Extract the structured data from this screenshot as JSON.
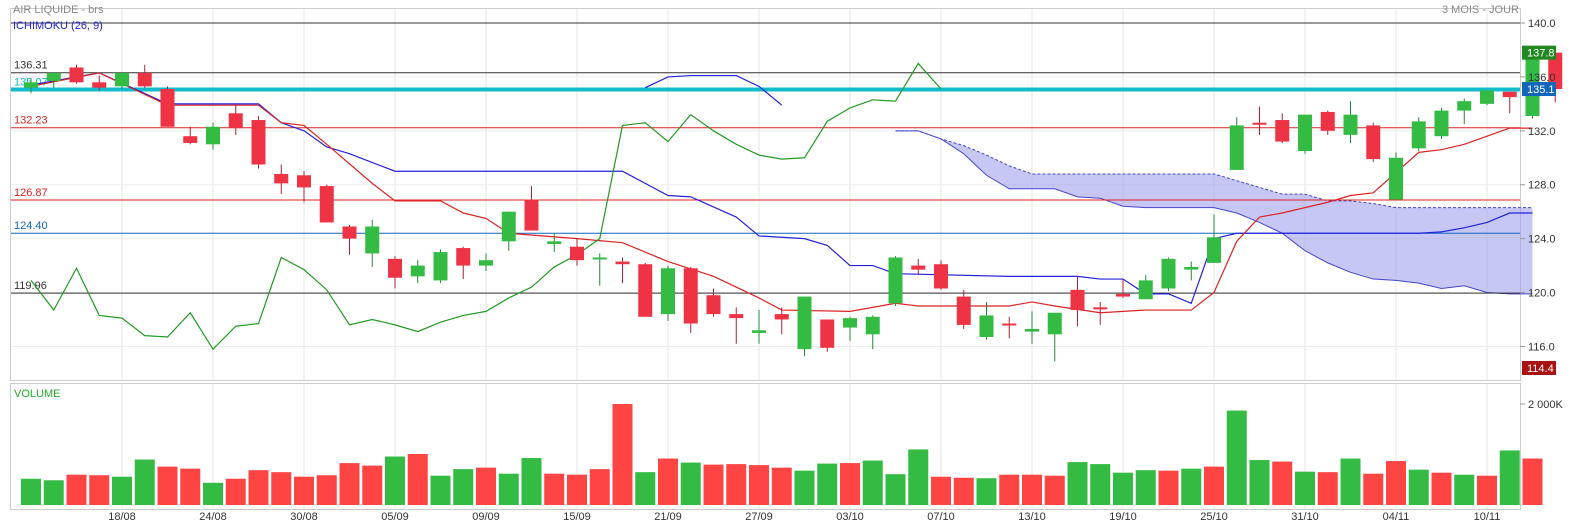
{
  "header": {
    "instrument": "AIR LIQUIDE - brs",
    "period": "3 MOIS - JOUR",
    "indicator": "ICHIMOKU (26, 9)",
    "volume_title": "VOLUME"
  },
  "colors": {
    "up": "#33bb44",
    "down": "#ee3344",
    "tenkan": "#dd2222",
    "kijun": "#2222dd",
    "chikou": "#229922",
    "cloud": "#9999ee",
    "last_line": "#11bbcc",
    "ref_line": "#333333",
    "vol_up": "#33bb44",
    "vol_down": "#ff4444"
  },
  "chart_data": {
    "type": "candlestick",
    "price_axis": {
      "min": 114.4,
      "max": 140.0,
      "ticks": [
        "140.0",
        "136.0",
        "132.0",
        "128.0",
        "124.0",
        "120.0",
        "116.0"
      ]
    },
    "x_labels": [
      "18/08",
      "24/08",
      "30/08",
      "05/09",
      "09/09",
      "15/09",
      "21/09",
      "27/09",
      "03/10",
      "07/10",
      "13/10",
      "19/10",
      "25/10",
      "31/10",
      "04/11",
      "10/11"
    ],
    "x_label_index": [
      4,
      8,
      12,
      16,
      20,
      24,
      28,
      32,
      36,
      40,
      44,
      48,
      52,
      56,
      60,
      64
    ],
    "reference_lines": [
      {
        "label": "136.31",
        "value": 136.31,
        "color": "#333333"
      },
      {
        "label": "135.07",
        "value": 135.07,
        "color": "#11bbcc"
      },
      {
        "label": "132.23",
        "value": 132.23,
        "color": "#dd2222"
      },
      {
        "label": "126.87",
        "value": 126.87,
        "color": "#dd2222"
      },
      {
        "label": "124.40",
        "value": 124.4,
        "color": "#1166bb"
      },
      {
        "label": "119.96",
        "value": 119.96,
        "color": "#333333"
      }
    ],
    "top_line_value": 140.0,
    "price_badges": [
      {
        "label": "137.8",
        "value": 137.8,
        "color": "#228822"
      },
      {
        "label": "135.1",
        "value": 135.1,
        "color": "#1166bb"
      },
      {
        "label": "114.4",
        "value": 114.4,
        "color": "#aa1111"
      }
    ],
    "candles": [
      [
        135.2,
        135.9,
        134.8,
        135.6
      ],
      [
        135.7,
        136.1,
        135.2,
        136.3
      ],
      [
        136.7,
        136.9,
        135.5,
        135.6
      ],
      [
        135.6,
        136.1,
        135.0,
        135.2
      ],
      [
        135.3,
        136.3,
        135.1,
        136.3
      ],
      [
        136.3,
        136.9,
        135.2,
        135.3
      ],
      [
        135.1,
        135.3,
        132.3,
        132.3
      ],
      [
        131.6,
        132.3,
        131.0,
        131.1
      ],
      [
        131.0,
        132.6,
        130.6,
        132.3
      ],
      [
        133.3,
        134.0,
        131.7,
        132.2
      ],
      [
        132.8,
        133.1,
        129.2,
        129.5
      ],
      [
        128.8,
        129.5,
        127.3,
        128.1
      ],
      [
        128.7,
        129.0,
        126.7,
        127.8
      ],
      [
        127.9,
        128.0,
        125.2,
        125.2
      ],
      [
        124.9,
        125.0,
        122.8,
        124.0
      ],
      [
        122.9,
        125.4,
        121.9,
        124.9
      ],
      [
        122.5,
        122.7,
        120.3,
        121.1
      ],
      [
        121.2,
        122.4,
        120.7,
        122.0
      ],
      [
        120.9,
        123.2,
        120.7,
        123.0
      ],
      [
        123.3,
        123.4,
        121.0,
        122.0
      ],
      [
        122.0,
        122.9,
        121.6,
        122.4
      ],
      [
        123.8,
        126.0,
        123.1,
        126.0
      ],
      [
        126.9,
        127.9,
        124.6,
        124.6
      ],
      [
        123.6,
        124.4,
        123.0,
        123.8
      ],
      [
        123.4,
        124.0,
        122.0,
        122.4
      ],
      [
        122.5,
        122.9,
        120.5,
        122.6
      ],
      [
        122.3,
        122.6,
        120.7,
        122.1
      ],
      [
        122.1,
        122.2,
        120.0,
        118.2
      ],
      [
        118.4,
        122.0,
        117.9,
        121.8
      ],
      [
        121.8,
        121.9,
        117.0,
        117.7
      ],
      [
        119.8,
        120.3,
        118.2,
        118.4
      ],
      [
        118.4,
        118.9,
        116.2,
        118.1
      ],
      [
        117.0,
        118.7,
        116.2,
        117.2
      ],
      [
        118.4,
        118.9,
        116.9,
        118.0
      ],
      [
        115.8,
        118.3,
        115.3,
        119.7
      ],
      [
        118.0,
        118.0,
        115.6,
        115.9
      ],
      [
        117.4,
        118.2,
        116.4,
        118.1
      ],
      [
        116.9,
        118.3,
        115.8,
        118.2
      ],
      [
        119.2,
        122.7,
        119.0,
        122.6
      ],
      [
        122.0,
        122.5,
        121.3,
        121.7
      ],
      [
        122.1,
        122.4,
        120.2,
        120.3
      ],
      [
        119.7,
        120.2,
        117.3,
        117.6
      ],
      [
        116.7,
        119.3,
        116.5,
        118.3
      ],
      [
        117.7,
        118.2,
        116.6,
        117.6
      ],
      [
        117.1,
        118.6,
        116.2,
        117.3
      ],
      [
        116.9,
        118.3,
        114.9,
        118.5
      ],
      [
        120.2,
        121.2,
        117.5,
        118.7
      ],
      [
        118.9,
        119.3,
        117.6,
        118.8
      ],
      [
        119.9,
        121.0,
        119.6,
        119.7
      ],
      [
        119.5,
        121.3,
        120.5,
        120.9
      ],
      [
        120.3,
        122.6,
        120.1,
        122.5
      ],
      [
        121.7,
        122.3,
        120.9,
        121.9
      ],
      [
        122.2,
        125.8,
        122.2,
        124.1
      ],
      [
        129.1,
        133.0,
        129.1,
        132.4
      ],
      [
        132.6,
        133.8,
        131.7,
        132.5
      ],
      [
        132.8,
        133.3,
        131.1,
        131.2
      ],
      [
        130.5,
        133.2,
        130.3,
        133.2
      ],
      [
        133.4,
        133.5,
        131.7,
        132.0
      ],
      [
        131.7,
        134.2,
        131.1,
        133.2
      ],
      [
        132.4,
        132.6,
        129.7,
        129.9
      ],
      [
        126.9,
        130.4,
        126.9,
        130.0
      ],
      [
        130.7,
        133.0,
        130.5,
        132.7
      ],
      [
        131.6,
        133.7,
        131.4,
        133.5
      ],
      [
        133.5,
        134.4,
        132.5,
        134.2
      ],
      [
        134.0,
        135.0,
        133.9,
        135.0
      ],
      [
        134.9,
        134.7,
        133.3,
        134.5
      ],
      [
        133.1,
        137.9,
        132.9,
        137.8
      ],
      [
        137.8,
        137.8,
        134.1,
        135.1
      ]
    ],
    "volume_axis": {
      "max": 2000,
      "tick_label": "2 000K"
    },
    "volumes": [
      [
        520,
        1
      ],
      [
        490,
        1
      ],
      [
        600,
        0
      ],
      [
        590,
        0
      ],
      [
        560,
        1
      ],
      [
        900,
        1
      ],
      [
        760,
        0
      ],
      [
        720,
        0
      ],
      [
        440,
        1
      ],
      [
        520,
        0
      ],
      [
        690,
        0
      ],
      [
        650,
        0
      ],
      [
        560,
        0
      ],
      [
        590,
        0
      ],
      [
        830,
        0
      ],
      [
        780,
        0
      ],
      [
        960,
        1
      ],
      [
        1010,
        0
      ],
      [
        580,
        1
      ],
      [
        710,
        1
      ],
      [
        740,
        0
      ],
      [
        620,
        1
      ],
      [
        930,
        1
      ],
      [
        620,
        0
      ],
      [
        600,
        0
      ],
      [
        710,
        0
      ],
      [
        2000,
        0
      ],
      [
        650,
        1
      ],
      [
        920,
        0
      ],
      [
        840,
        1
      ],
      [
        800,
        0
      ],
      [
        810,
        0
      ],
      [
        790,
        0
      ],
      [
        740,
        0
      ],
      [
        680,
        1
      ],
      [
        820,
        1
      ],
      [
        830,
        0
      ],
      [
        880,
        1
      ],
      [
        610,
        1
      ],
      [
        1100,
        1
      ],
      [
        560,
        0
      ],
      [
        540,
        0
      ],
      [
        530,
        1
      ],
      [
        600,
        0
      ],
      [
        600,
        0
      ],
      [
        580,
        0
      ],
      [
        850,
        1
      ],
      [
        810,
        1
      ],
      [
        640,
        1
      ],
      [
        690,
        1
      ],
      [
        680,
        0
      ],
      [
        720,
        1
      ],
      [
        760,
        0
      ],
      [
        1870,
        1
      ],
      [
        890,
        1
      ],
      [
        860,
        0
      ],
      [
        660,
        1
      ],
      [
        650,
        0
      ],
      [
        920,
        1
      ],
      [
        620,
        0
      ],
      [
        870,
        0
      ],
      [
        700,
        1
      ],
      [
        640,
        0
      ],
      [
        600,
        1
      ],
      [
        580,
        0
      ],
      [
        1080,
        1
      ],
      [
        920,
        0
      ]
    ],
    "tenkan": [
      [
        0,
        135.3
      ],
      [
        3,
        136.3
      ],
      [
        6,
        133.9
      ],
      [
        10,
        133.9
      ],
      [
        11,
        132.6
      ],
      [
        12,
        132.4
      ],
      [
        13,
        131.0
      ],
      [
        15,
        128.1
      ],
      [
        16,
        126.8
      ],
      [
        18,
        126.8
      ],
      [
        19,
        125.9
      ],
      [
        20,
        125.5
      ],
      [
        21,
        124.4
      ],
      [
        24,
        124.0
      ],
      [
        26,
        123.7
      ],
      [
        28,
        122.3
      ],
      [
        30,
        121.2
      ],
      [
        32,
        119.6
      ],
      [
        33,
        118.7
      ],
      [
        36,
        118.6
      ],
      [
        37,
        118.9
      ],
      [
        38,
        119.2
      ],
      [
        39,
        119.0
      ],
      [
        40,
        119.0
      ],
      [
        43,
        119.0
      ],
      [
        44,
        119.3
      ],
      [
        45,
        119.0
      ],
      [
        47,
        118.5
      ],
      [
        49,
        118.7
      ],
      [
        50,
        118.7
      ],
      [
        51,
        118.7
      ],
      [
        52,
        120.0
      ],
      [
        53,
        123.8
      ],
      [
        54,
        125.6
      ],
      [
        55,
        125.9
      ],
      [
        56,
        126.3
      ],
      [
        57,
        126.7
      ],
      [
        58,
        127.2
      ],
      [
        59,
        127.4
      ],
      [
        61,
        130.4
      ],
      [
        62,
        130.6
      ],
      [
        63,
        131.0
      ],
      [
        64,
        131.6
      ],
      [
        65,
        132.2
      ],
      [
        66,
        132.2
      ]
    ],
    "kijun": [
      [
        0,
        135.4
      ],
      [
        3,
        136.3
      ],
      [
        6,
        134.0
      ],
      [
        10,
        134.0
      ],
      [
        11,
        132.6
      ],
      [
        12,
        132.0
      ],
      [
        13,
        130.8
      ],
      [
        14,
        130.3
      ],
      [
        16,
        129.0
      ],
      [
        26,
        129.0
      ],
      [
        27,
        128.1
      ],
      [
        28,
        127.2
      ],
      [
        29,
        127.1
      ],
      [
        31,
        125.6
      ],
      [
        32,
        124.2
      ],
      [
        34,
        124.0
      ],
      [
        35,
        123.5
      ],
      [
        36,
        122.0
      ],
      [
        37,
        122.0
      ],
      [
        38,
        121.4
      ],
      [
        43,
        121.2
      ],
      [
        46,
        121.2
      ],
      [
        47,
        121.0
      ],
      [
        48,
        121.0
      ],
      [
        49,
        119.9
      ],
      [
        50,
        119.9
      ],
      [
        51,
        119.2
      ],
      [
        52,
        124.0
      ],
      [
        53,
        124.4
      ],
      [
        54,
        124.4
      ],
      [
        55,
        124.4
      ],
      [
        56,
        124.4
      ],
      [
        57,
        124.4
      ],
      [
        58,
        124.4
      ],
      [
        59,
        124.4
      ],
      [
        60,
        124.4
      ],
      [
        61,
        124.4
      ],
      [
        62,
        124.5
      ],
      [
        63,
        124.8
      ],
      [
        64,
        125.2
      ],
      [
        65,
        125.9
      ],
      [
        66,
        125.9
      ]
    ],
    "chikou": [
      [
        0,
        120.9
      ],
      [
        1,
        118.7
      ],
      [
        2,
        121.8
      ],
      [
        3,
        118.3
      ],
      [
        4,
        118.1
      ],
      [
        5,
        116.8
      ],
      [
        6,
        116.7
      ],
      [
        7,
        118.5
      ],
      [
        8,
        115.8
      ],
      [
        9,
        117.5
      ],
      [
        10,
        117.7
      ],
      [
        11,
        122.6
      ],
      [
        12,
        121.7
      ],
      [
        13,
        120.2
      ],
      [
        14,
        117.6
      ],
      [
        15,
        118.0
      ],
      [
        16,
        117.6
      ],
      [
        17,
        117.1
      ],
      [
        18,
        117.8
      ],
      [
        19,
        118.3
      ],
      [
        20,
        118.6
      ],
      [
        21,
        119.6
      ],
      [
        22,
        120.4
      ],
      [
        23,
        121.9
      ],
      [
        24,
        122.8
      ],
      [
        25,
        124.0
      ],
      [
        26,
        132.4
      ],
      [
        27,
        132.6
      ],
      [
        28,
        131.2
      ],
      [
        29,
        133.2
      ],
      [
        30,
        132.0
      ],
      [
        31,
        131.0
      ],
      [
        32,
        130.2
      ],
      [
        33,
        129.9
      ],
      [
        34,
        130.0
      ],
      [
        35,
        132.7
      ],
      [
        36,
        133.7
      ],
      [
        37,
        134.3
      ],
      [
        38,
        134.2
      ],
      [
        39,
        137.0
      ],
      [
        40,
        135.1
      ]
    ],
    "kijun_upper_stub": [
      [
        27,
        135.2
      ],
      [
        28,
        136.0
      ],
      [
        29,
        136.1
      ],
      [
        30,
        136.1
      ],
      [
        31,
        136.1
      ],
      [
        32,
        135.3
      ],
      [
        33,
        133.9
      ]
    ],
    "senkou_a": [
      [
        38,
        132.0
      ],
      [
        39,
        132.0
      ],
      [
        40,
        131.4
      ],
      [
        41,
        130.9
      ],
      [
        42,
        130.2
      ],
      [
        43,
        129.4
      ],
      [
        44,
        128.8
      ],
      [
        45,
        128.8
      ],
      [
        46,
        128.8
      ],
      [
        47,
        128.8
      ],
      [
        48,
        128.8
      ],
      [
        49,
        128.8
      ],
      [
        50,
        128.8
      ],
      [
        51,
        128.8
      ],
      [
        52,
        128.8
      ],
      [
        53,
        128.3
      ],
      [
        54,
        127.8
      ],
      [
        55,
        127.3
      ],
      [
        56,
        127.3
      ],
      [
        57,
        126.8
      ],
      [
        58,
        126.8
      ],
      [
        59,
        126.6
      ],
      [
        60,
        126.3
      ],
      [
        61,
        126.3
      ],
      [
        62,
        126.3
      ],
      [
        63,
        126.3
      ],
      [
        64,
        126.3
      ],
      [
        65,
        126.3
      ],
      [
        66,
        126.3
      ]
    ],
    "senkou_b": [
      [
        38,
        132.0
      ],
      [
        39,
        132.0
      ],
      [
        40,
        131.4
      ],
      [
        41,
        130.3
      ],
      [
        42,
        128.7
      ],
      [
        43,
        127.7
      ],
      [
        44,
        127.7
      ],
      [
        45,
        127.7
      ],
      [
        46,
        127.1
      ],
      [
        47,
        127.0
      ],
      [
        48,
        126.4
      ],
      [
        49,
        126.3
      ],
      [
        50,
        126.3
      ],
      [
        51,
        126.3
      ],
      [
        52,
        126.3
      ],
      [
        53,
        125.9
      ],
      [
        54,
        125.2
      ],
      [
        55,
        124.4
      ],
      [
        56,
        123.1
      ],
      [
        57,
        122.2
      ],
      [
        58,
        121.5
      ],
      [
        59,
        121.0
      ],
      [
        60,
        120.9
      ],
      [
        61,
        120.7
      ],
      [
        62,
        120.3
      ],
      [
        63,
        120.5
      ],
      [
        64,
        120.0
      ],
      [
        65,
        119.9
      ],
      [
        66,
        119.9
      ]
    ]
  }
}
